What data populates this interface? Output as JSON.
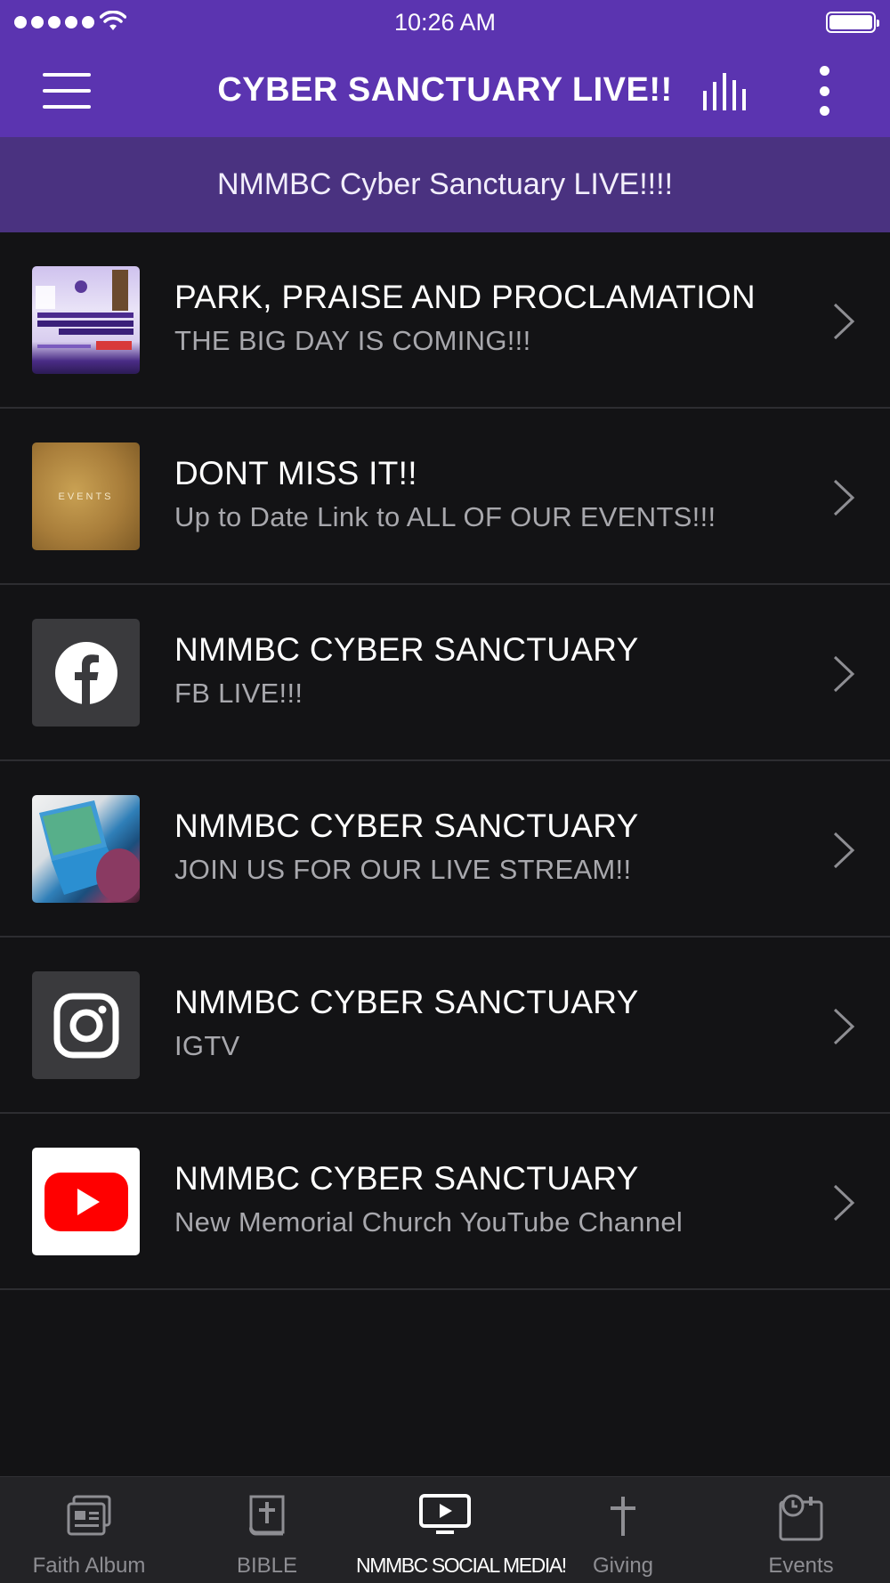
{
  "status_bar": {
    "time": "10:26 AM"
  },
  "header": {
    "title": "CYBER SANCTUARY LIVE!!"
  },
  "subheader": {
    "text": "NMMBC Cyber Sanctuary LIVE!!!!"
  },
  "list": [
    {
      "title": "PARK, PRAISE AND PROCLAMATION",
      "subtitle": "THE BIG DAY IS COMING!!!",
      "thumb": "event-poster"
    },
    {
      "title": "DONT MISS IT!!",
      "subtitle": "Up to Date Link to ALL OF OUR EVENTS!!!",
      "thumb": "events-image",
      "thumb_text": "EVENTS"
    },
    {
      "title": "NMMBC CYBER SANCTUARY",
      "subtitle": "FB LIVE!!!",
      "thumb": "facebook-icon"
    },
    {
      "title": "NMMBC CYBER SANCTUARY",
      "subtitle": "JOIN US FOR OUR LIVE STREAM!!",
      "thumb": "laptop-photo"
    },
    {
      "title": "NMMBC CYBER SANCTUARY",
      "subtitle": "IGTV",
      "thumb": "instagram-icon"
    },
    {
      "title": "NMMBC CYBER SANCTUARY",
      "subtitle": "New Memorial Church YouTube Channel",
      "thumb": "youtube-icon"
    }
  ],
  "tabs": [
    {
      "label": "Faith Album",
      "icon": "album-icon",
      "active": false
    },
    {
      "label": "BIBLE",
      "icon": "bible-icon",
      "active": false
    },
    {
      "label": "NMMBC SOCIAL MEDIA!",
      "icon": "tv-play-icon",
      "active": true
    },
    {
      "label": "Giving",
      "icon": "cross-icon",
      "active": false
    },
    {
      "label": "Events",
      "icon": "calendar-icon",
      "active": false
    }
  ],
  "colors": {
    "header_purple": "#5b34b0",
    "subheader_purple": "#4a3280",
    "background": "#131315",
    "tabbar": "#232326",
    "inactive_tab": "#8e8e93"
  }
}
